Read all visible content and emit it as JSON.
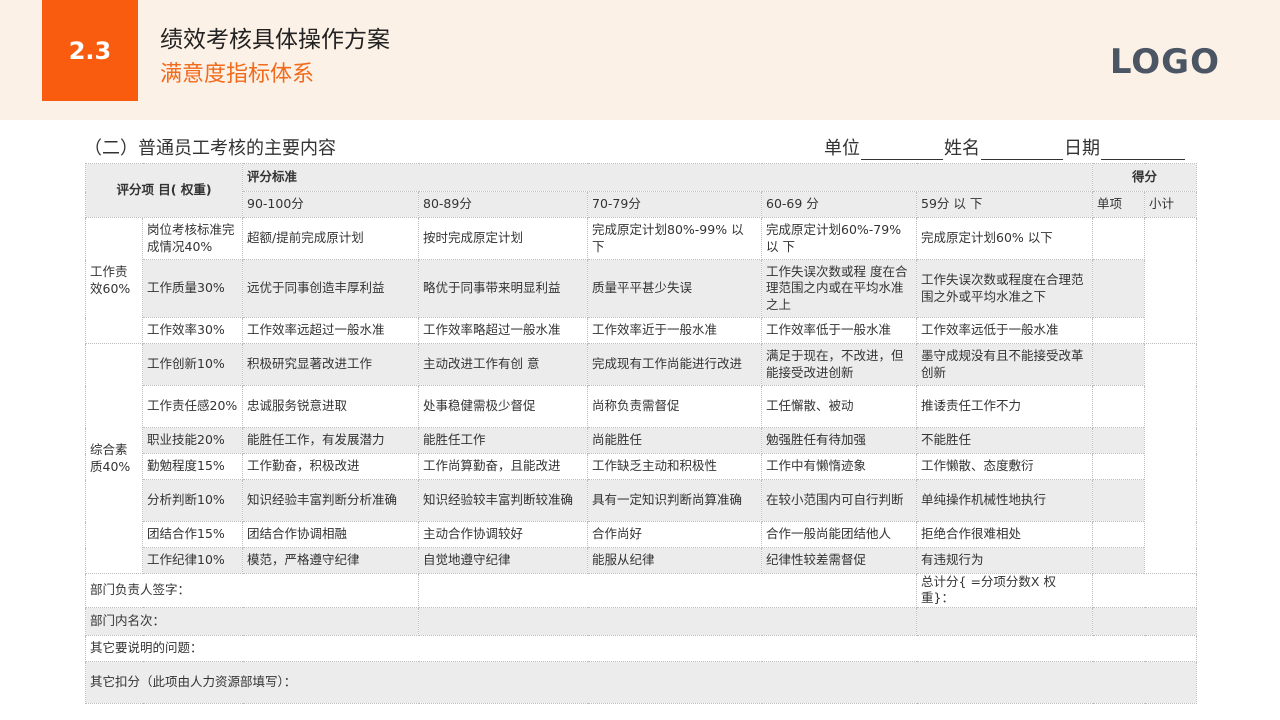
{
  "header": {
    "badge": "2.3",
    "title": "绩效考核具体操作方案",
    "subtitle": "满意度指标体系",
    "logo": "LOGO"
  },
  "section_heading": "（二）普通员工考核的主要内容",
  "meta_labels": {
    "unit": "单位",
    "name": "姓名",
    "date": "日期"
  },
  "table": {
    "item_header": "评分项 目( 权重)",
    "criteria_header": "评分标准",
    "score_header": "得分",
    "bands": [
      "90-100分",
      "80-89分",
      "70-79分",
      "60-69 分",
      "59分 以 下"
    ],
    "score_cols": [
      "单项",
      "小计"
    ],
    "groups": [
      {
        "name": "工作责效60%",
        "rows": [
          {
            "item": "岗位考核标准完成情况40%",
            "c": [
              "超额/提前完成原计划",
              "按时完成原定计划",
              "完成原定计划80%-99% 以 下",
              "完成原定计划60%-79% 以 下",
              "完成原定计划60% 以下"
            ]
          },
          {
            "item": "工作质量30%",
            "c": [
              "远优于同事创造丰厚利益",
              "略优于同事带来明显利益",
              "质量平平甚少失误",
              "工作失误次数或程 度在合理范围之内或在平均水准之上",
              "工作失误次数或程度在合理范围之外或平均水准之下"
            ]
          },
          {
            "item": "工作效率30%",
            "c": [
              "工作效率远超过一般水准",
              "工作效率略超过一般水准",
              "工作效率近于一般水准",
              "工作效率低于一般水准",
              "工作效率远低于一般水准"
            ]
          }
        ]
      },
      {
        "name": "综合素质40%",
        "rows": [
          {
            "item": "工作创新10%",
            "c": [
              "积极研究显著改进工作",
              "主动改进工作有创 意",
              "完成现有工作尚能进行改进",
              "满足于现在，不改进，但能接受改进创新",
              "墨守成规没有且不能接受改革创新"
            ]
          },
          {
            "item": "工作责任感20%",
            "c": [
              "忠诚服务锐意进取",
              "处事稳健需极少督促",
              "尚称负责需督促",
              "工任懈散、被动",
              "推诿责任工作不力"
            ]
          },
          {
            "item": "职业技能20%",
            "c": [
              "能胜任工作，有发展潜力",
              "能胜任工作",
              "尚能胜任",
              "勉强胜任有待加强",
              "不能胜任"
            ]
          },
          {
            "item": "勤勉程度15%",
            "c": [
              "工作勤奋，积极改进",
              "工作尚算勤奋，且能改进",
              "工作缺乏主动和积极性",
              "工作中有懒惰迹象",
              "工作懒散、态度敷衍"
            ]
          },
          {
            "item": "分析判断10%",
            "c": [
              "知识经验丰富判断分析准确",
              "知识经验较丰富判断较准确",
              "具有一定知识判断尚算准确",
              "在较小范围内可自行判断",
              "单纯操作机械性地执行"
            ]
          },
          {
            "item": "团结合作15%",
            "c": [
              "团结合作协调相融",
              "主动合作协调较好",
              "合作尚好",
              "合作一般尚能团结他人",
              "拒绝合作很难相处"
            ]
          },
          {
            "item": "工作纪律10%",
            "c": [
              "模范，严格遵守纪律",
              "自觉地遵守纪律",
              "能服从纪律",
              "纪律性较差需督促",
              "有违规行为"
            ]
          }
        ]
      }
    ],
    "footer": {
      "sign": "部门负责人签字：",
      "total": "总计分{ =分项分数X 权重}：",
      "rank": "部门内名次：",
      "notes": "其它要说明的问题：",
      "deduct": "其它扣分（此项由人力资源部填写）："
    }
  }
}
